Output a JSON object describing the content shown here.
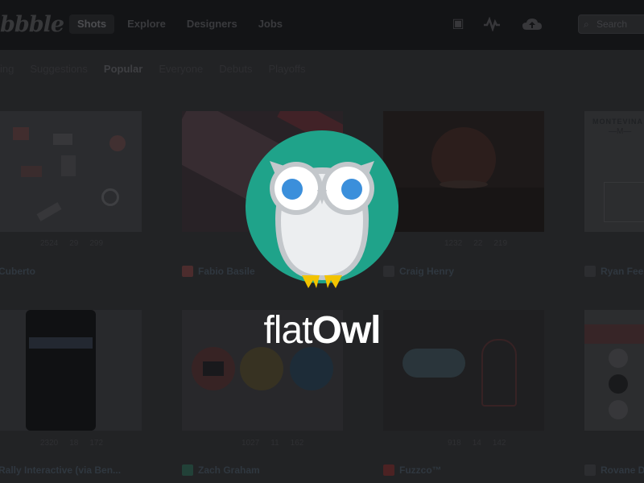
{
  "topnav": {
    "logo": "bbble",
    "items": [
      "Shots",
      "Explore",
      "Designers",
      "Jobs"
    ],
    "active": "Shots",
    "search_placeholder": "Search"
  },
  "subnav": {
    "items": [
      "ing",
      "Suggestions",
      "Popular",
      "Everyone",
      "Debuts",
      "Playoffs"
    ],
    "active": "Popular"
  },
  "shots": [
    {
      "author": "Cuberto",
      "views": "2524",
      "comments": "29",
      "likes": "299"
    },
    {
      "author": "Fabio Basile",
      "views": "",
      "comments": "",
      "likes": ""
    },
    {
      "author": "Craig Henry",
      "views": "1232",
      "comments": "22",
      "likes": "219"
    },
    {
      "author": "Ryan Fee",
      "views": "",
      "comments": "",
      "likes": ""
    },
    {
      "author": "Rally Interactive (via Ben...",
      "views": "2320",
      "comments": "18",
      "likes": "172"
    },
    {
      "author": "Zach Graham",
      "views": "1027",
      "comments": "11",
      "likes": "162"
    },
    {
      "author": "Fuzzco™",
      "views": "918",
      "comments": "14",
      "likes": "142"
    },
    {
      "author": "Rovane D",
      "views": "",
      "comments": "",
      "likes": ""
    }
  ],
  "brand": {
    "light": "flat",
    "bold": "Owl"
  },
  "colors": {
    "owl_circle": "#1fa38a",
    "owl_body": "#eceef0",
    "owl_outline": "#c3c7cb",
    "owl_eye": "#3b8fdb",
    "owl_feet": "#f2c300",
    "text": "#ffffff"
  }
}
